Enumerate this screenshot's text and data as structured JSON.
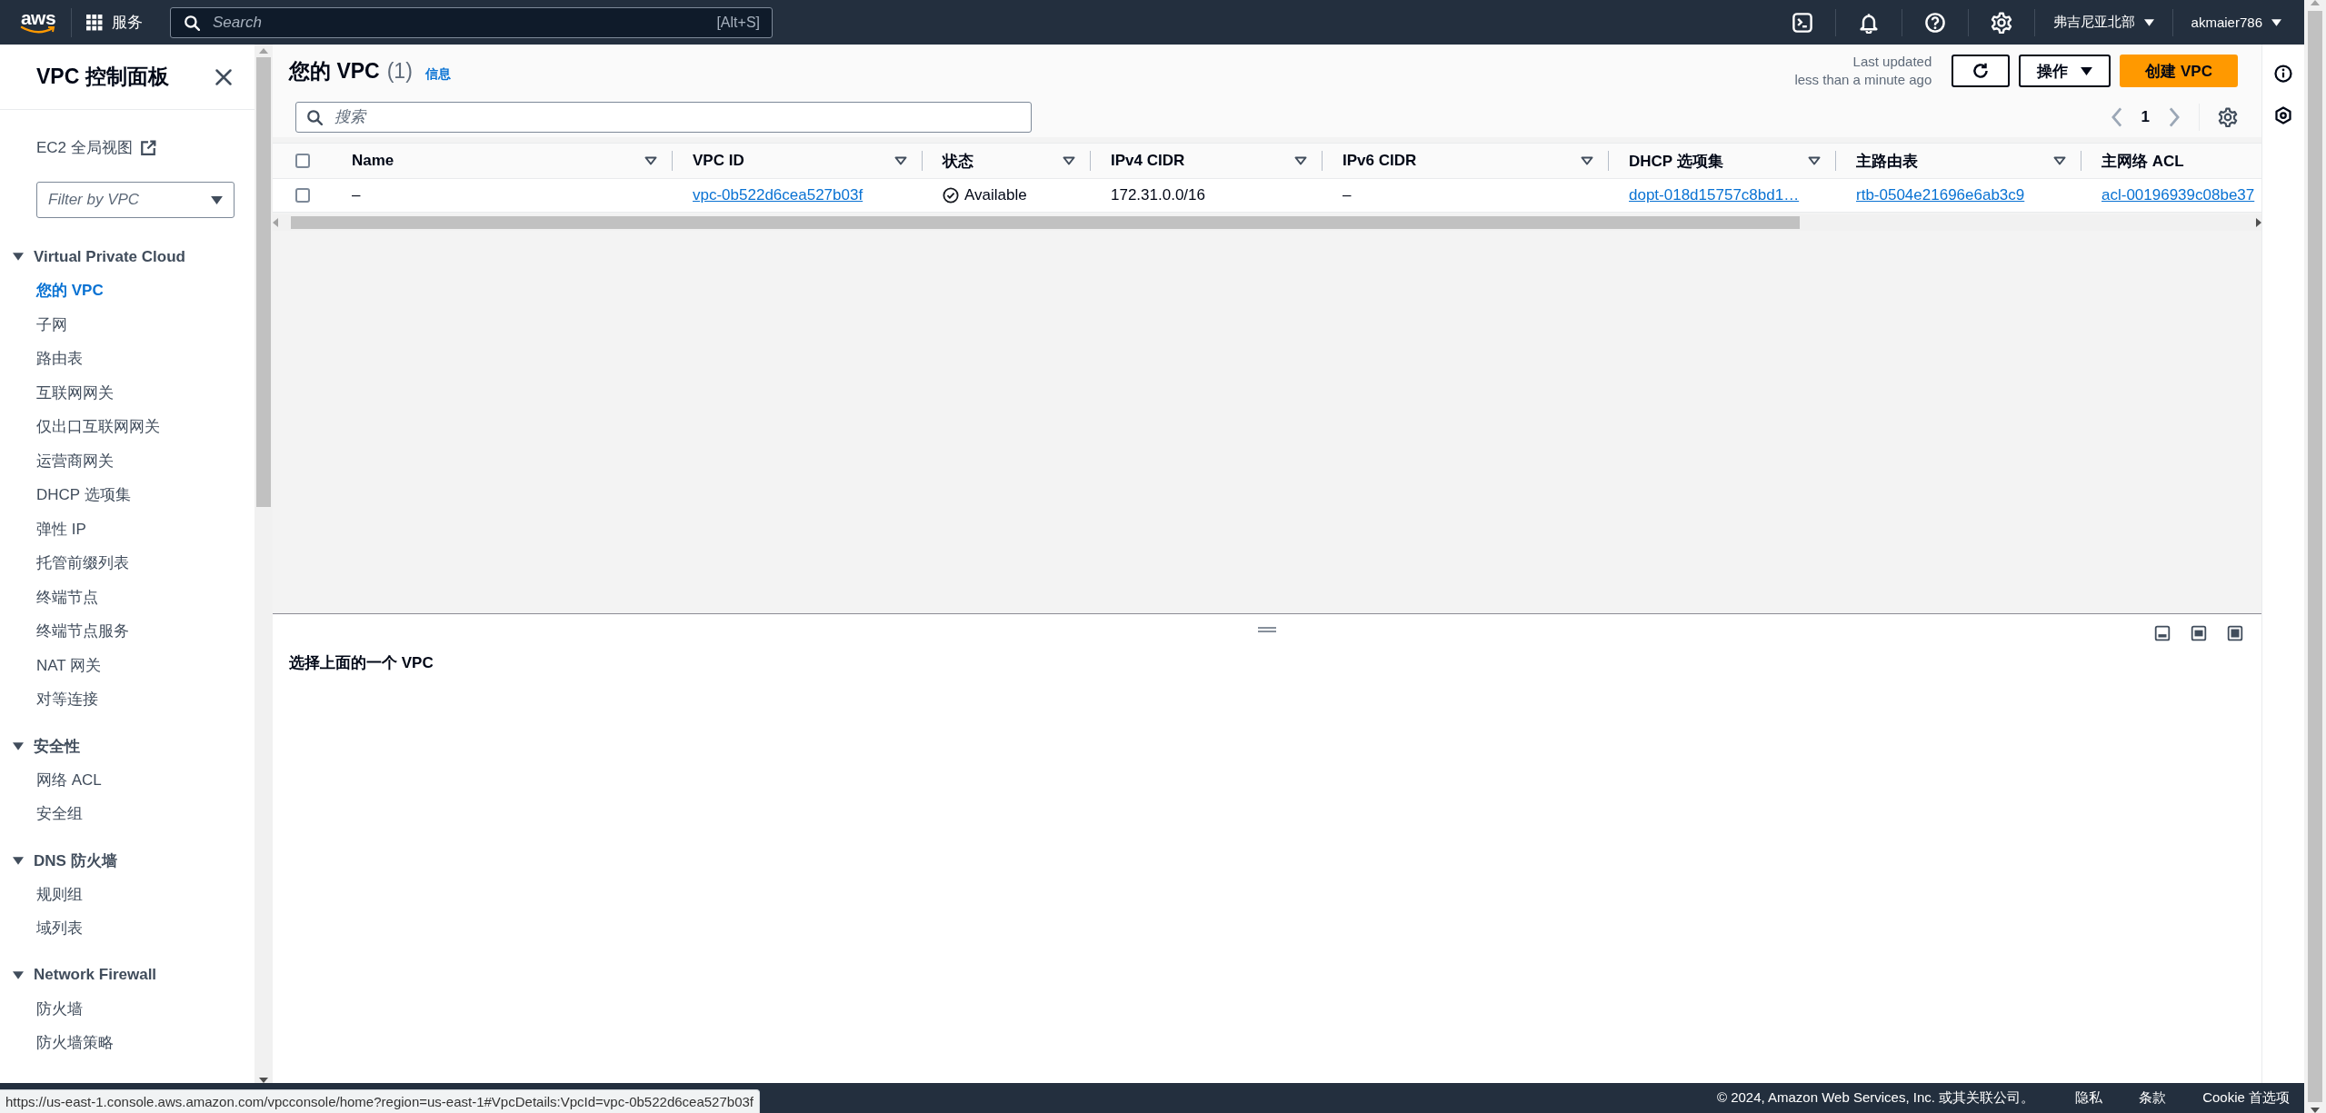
{
  "top_nav": {
    "logo_text": "aws",
    "services_label": "服务",
    "search": {
      "placeholder": "Search",
      "shortcut": "[Alt+S]"
    },
    "region": "弗吉尼亚北部",
    "account": "akmaier786"
  },
  "sidebar": {
    "title": "VPC 控制面板",
    "ec2_link": "EC2 全局视图",
    "filter": {
      "placeholder": "Filter by VPC"
    },
    "sections": [
      {
        "title": "Virtual Private Cloud",
        "expanded": true,
        "items": [
          {
            "label": "您的 VPC",
            "selected": true
          },
          {
            "label": "子网",
            "selected": false
          },
          {
            "label": "路由表",
            "selected": false
          },
          {
            "label": "互联网网关",
            "selected": false
          },
          {
            "label": "仅出口互联网网关",
            "selected": false
          },
          {
            "label": "运营商网关",
            "selected": false
          },
          {
            "label": "DHCP 选项集",
            "selected": false
          },
          {
            "label": "弹性 IP",
            "selected": false
          },
          {
            "label": "托管前缀列表",
            "selected": false
          },
          {
            "label": "终端节点",
            "selected": false
          },
          {
            "label": "终端节点服务",
            "selected": false
          },
          {
            "label": "NAT 网关",
            "selected": false
          },
          {
            "label": "对等连接",
            "selected": false
          }
        ]
      },
      {
        "title": "安全性",
        "expanded": true,
        "items": [
          {
            "label": "网络 ACL",
            "selected": false
          },
          {
            "label": "安全组",
            "selected": false
          }
        ]
      },
      {
        "title": "DNS 防火墙",
        "expanded": true,
        "items": [
          {
            "label": "规则组",
            "selected": false
          },
          {
            "label": "域列表",
            "selected": false
          }
        ]
      },
      {
        "title": "Network Firewall",
        "expanded": true,
        "items": [
          {
            "label": "防火墙",
            "selected": false
          },
          {
            "label": "防火墙策略",
            "selected": false
          }
        ]
      }
    ]
  },
  "vpc_panel": {
    "title": "您的 VPC",
    "count": "(1)",
    "info": "信息",
    "last_updated": "Last updated",
    "last_updated_time": "less than a minute ago",
    "actions_button": "操作",
    "create_button": "创建 VPC",
    "search": {
      "placeholder": "搜索"
    },
    "page": "1",
    "table": {
      "all_selected": false,
      "columns": [
        "Name",
        "VPC ID",
        "状态",
        "IPv4 CIDR",
        "IPv6 CIDR",
        "DHCP 选项集",
        "主路由表",
        "主网络 ACL"
      ],
      "rows": [
        {
          "selected": false,
          "cells": [
            {
              "kind": "text",
              "text": "–"
            },
            {
              "kind": "link",
              "text": "vpc-0b522d6cea527b03f"
            },
            {
              "kind": "status",
              "text": "Available"
            },
            {
              "kind": "text",
              "text": "172.31.0.0/16"
            },
            {
              "kind": "text",
              "text": "–"
            },
            {
              "kind": "link",
              "text": "dopt-018d15757c8bd1…"
            },
            {
              "kind": "link",
              "text": "rtb-0504e21696e6ab3c9"
            },
            {
              "kind": "link",
              "text": "acl-00196939c08be37"
            }
          ]
        }
      ]
    }
  },
  "details_panel": {
    "message": "选择上面的一个 VPC"
  },
  "footer": {
    "copyright": "© 2024, Amazon Web Services, Inc. 或其关联公司。",
    "links": [
      "隐私",
      "条款",
      "Cookie 首选项"
    ]
  },
  "status_url": "https://us-east-1.console.aws.amazon.com/vpcconsole/home?region=us-east-1#VpcDetails:VpcId=vpc-0b522d6cea527b03f"
}
